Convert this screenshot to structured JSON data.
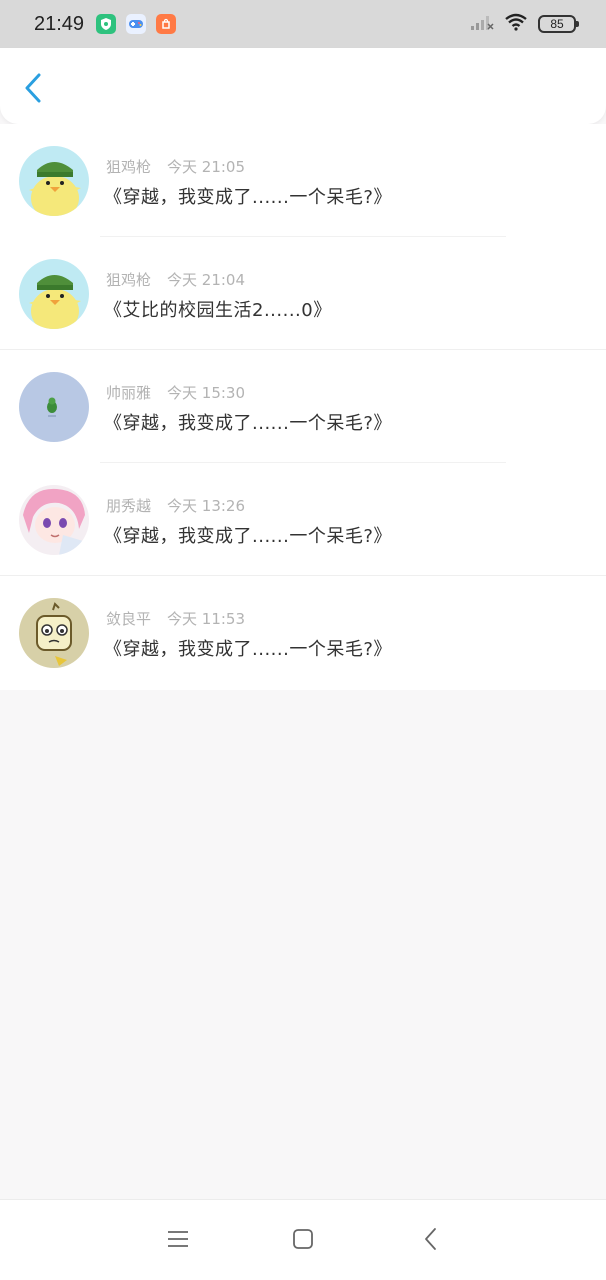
{
  "status_bar": {
    "time": "21:49",
    "battery": "85",
    "apps": [
      {
        "icon": "shield-app-icon",
        "color": "#2ec27e"
      },
      {
        "icon": "game-app-icon",
        "color": "#eaf1ff"
      },
      {
        "icon": "mi-store-app-icon",
        "color": "#ff7a45"
      }
    ]
  },
  "header": {
    "back_icon": "chevron-left-icon",
    "accent": "#2a9fe0"
  },
  "comments": [
    {
      "user": "狙鸡枪",
      "time": "今天 21:05",
      "text": "《穿越，我变成了......一个呆毛?》",
      "avatar": "duck-avatar"
    },
    {
      "user": "狙鸡枪",
      "time": "今天 21:04",
      "text": "《艾比的校园生活2......0》",
      "avatar": "duck-avatar"
    },
    {
      "user": "帅丽雅",
      "time": "今天 15:30",
      "text": "《穿越，我变成了......一个呆毛?》",
      "avatar": "bird-avatar"
    },
    {
      "user": "朋秀越",
      "time": "今天 13:26",
      "text": "《穿越，我变成了......一个呆毛?》",
      "avatar": "anime-girl-avatar"
    },
    {
      "user": "敛良平",
      "time": "今天 11:53",
      "text": "《穿越，我变成了......一个呆毛?》",
      "avatar": "cartoon-avatar"
    }
  ],
  "nav": {
    "menu_icon": "menu-icon",
    "home_icon": "home-square-icon",
    "back_icon": "back-chevron-icon"
  }
}
